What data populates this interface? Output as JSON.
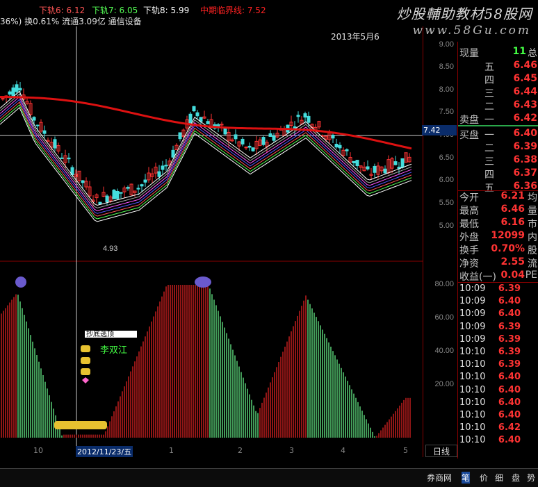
{
  "topbar": {
    "items": [
      {
        "text": "下轨6: 6.12",
        "color": "#ff5555"
      },
      {
        "text": "下轨7: 6.05",
        "color": "#55ff55"
      },
      {
        "text": "下轨8: 5.99",
        "color": "#ffffff"
      },
      {
        "text": "中期临界线: 7.52",
        "color": "#ff2222"
      }
    ]
  },
  "infobar": {
    "text": "36%) 换0.61% 流通3.09亿 通信设备"
  },
  "watermark": {
    "line1": "炒股輔助教材58股网",
    "line2": "www.58Gu.com"
  },
  "date_stamp": "2013年5月6",
  "price_axis": {
    "ticks": [
      "9.00",
      "8.50",
      "8.00",
      "7.50",
      "7.00",
      "6.50",
      "6.00",
      "5.50",
      "5.00"
    ]
  },
  "price_badge": "7.42",
  "low_marker": "4.93",
  "indicator_axis": {
    "ticks": [
      "80.00",
      "60.00",
      "40.00",
      "20.00"
    ]
  },
  "indicator_labels": {
    "banner": "李双江",
    "top_text": "抄底逃顶"
  },
  "x_axis": {
    "labels": [
      "10",
      "2012/11/23/五",
      "1",
      "2",
      "3",
      "4",
      "5"
    ]
  },
  "kline_period": "日线",
  "quote": {
    "volume_label": "现量",
    "volume_value": "11",
    "total_label": "总",
    "asks": [
      {
        "label": "五",
        "price": "6.46"
      },
      {
        "label": "四",
        "price": "6.45"
      },
      {
        "label": "三",
        "price": "6.44"
      },
      {
        "label": "二",
        "price": "6.43"
      },
      {
        "label": "卖盘 一",
        "price": "6.42"
      }
    ],
    "bids": [
      {
        "label": "买盘 一",
        "price": "6.40"
      },
      {
        "label": "二",
        "price": "6.39"
      },
      {
        "label": "三",
        "price": "6.38"
      },
      {
        "label": "四",
        "price": "6.37"
      },
      {
        "label": "五",
        "price": "6.36"
      }
    ],
    "stats": [
      {
        "label": "今开",
        "value": "6.21",
        "extra": "均"
      },
      {
        "label": "最高",
        "value": "6.46",
        "extra": "量"
      },
      {
        "label": "最低",
        "value": "6.16",
        "extra": "市"
      },
      {
        "label": "外盘",
        "value": "12099",
        "extra": "内"
      },
      {
        "label": "换手",
        "value": "0.70%",
        "extra": "股"
      },
      {
        "label": "净资",
        "value": "2.55",
        "extra": "流"
      },
      {
        "label": "收益(一)",
        "value": "0.04",
        "extra": "PE"
      }
    ],
    "ticks": [
      {
        "time": "10:09",
        "price": "6.39"
      },
      {
        "time": "10:09",
        "price": "6.40"
      },
      {
        "time": "10:09",
        "price": "6.40"
      },
      {
        "time": "10:09",
        "price": "6.39"
      },
      {
        "time": "10:09",
        "price": "6.39"
      },
      {
        "time": "10:10",
        "price": "6.39"
      },
      {
        "time": "10:10",
        "price": "6.39"
      },
      {
        "time": "10:10",
        "price": "6.40"
      },
      {
        "time": "10:10",
        "price": "6.40"
      },
      {
        "time": "10:10",
        "price": "6.40"
      },
      {
        "time": "10:10",
        "price": "6.40"
      },
      {
        "time": "10:10",
        "price": "6.42"
      },
      {
        "time": "10:10",
        "price": "6.40"
      }
    ]
  },
  "bottom_tabs": [
    "券商网",
    "笔",
    "价",
    "细",
    "盘",
    "势"
  ]
}
